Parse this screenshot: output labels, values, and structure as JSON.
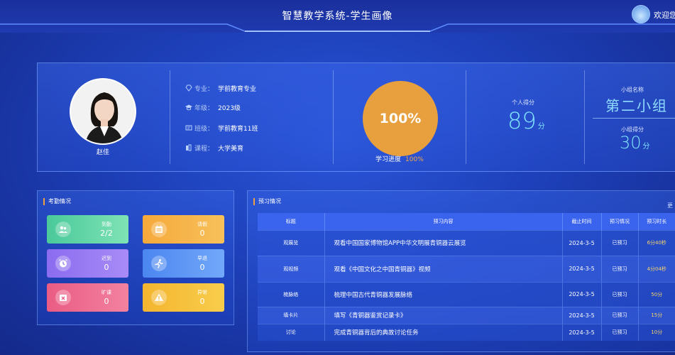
{
  "header": {
    "title": "智慧教学系统-学生画像",
    "welcome": "欢迎您"
  },
  "profile": {
    "name": "赵佳",
    "info": [
      {
        "label": "专业：",
        "value": "学前教育专业",
        "icon": "diamond-icon"
      },
      {
        "label": "年级：",
        "value": "2023级",
        "icon": "graduation-cap-icon"
      },
      {
        "label": "班级：",
        "value": "学前教育11班",
        "icon": "class-icon"
      },
      {
        "label": "课程：",
        "value": "大学美育",
        "icon": "books-icon"
      }
    ],
    "progress": {
      "percent_text": "100%",
      "label": "学习进度",
      "value": "100%",
      "value_fraction": 1.0
    },
    "personal_score": {
      "label": "个人得分",
      "value": "89",
      "unit": "分"
    },
    "group": {
      "name_label": "小组名称",
      "name": "第二小组",
      "score_label": "小组得分",
      "score": "30",
      "unit": "分"
    }
  },
  "attendance": {
    "title": "考勤情况",
    "tiles": [
      {
        "label": "到勤",
        "value": "2/2",
        "icon": "people-icon",
        "color": "#4ac99a"
      },
      {
        "label": "请假",
        "value": "0",
        "icon": "calendar-icon",
        "color": "#f6a93b"
      },
      {
        "label": "迟到",
        "value": "0",
        "icon": "alarm-clock-icon",
        "color": "#8b6cf0"
      },
      {
        "label": "早退",
        "value": "0",
        "icon": "running-icon",
        "color": "#4b86f0"
      },
      {
        "label": "旷课",
        "value": "0",
        "icon": "calendar-x-icon",
        "color": "#ea5c84"
      },
      {
        "label": "异常",
        "value": "0",
        "icon": "warning-icon",
        "color": "#f4b52f"
      }
    ]
  },
  "preview": {
    "title": "预习情况",
    "more": "更",
    "columns": [
      "标题",
      "预习内容",
      "截止时间",
      "预习情况",
      "预习时长"
    ],
    "rows": [
      {
        "title": "观展览",
        "content": "观看中国国家博物馆APP中华文明展青铜器云展览",
        "deadline": "2024-3-5",
        "status": "已预习",
        "duration": "6分40秒"
      },
      {
        "title": "观视频",
        "content": "观看《中国文化之中国青铜器》视频",
        "deadline": "2024-3-5",
        "status": "已预习",
        "duration": "4分04秒"
      },
      {
        "title": "梳脉络",
        "content": "梳理中国古代青铜器发展脉络",
        "deadline": "2024-3-5",
        "status": "已预习",
        "duration": "50分"
      },
      {
        "title": "填卡片",
        "content": "填写《青铜器鉴赏记录卡》",
        "deadline": "2024-3-5",
        "status": "已预习",
        "duration": "15分"
      },
      {
        "title": "讨论",
        "content": "完成青铜器背后的典故讨论任务",
        "deadline": "2024-3-5",
        "status": "已预习",
        "duration": "10分"
      }
    ]
  },
  "colors": {
    "accent_orange": "#e8a03e",
    "score_cyan": "#7fe3ff",
    "table_header": "#3b64ee"
  }
}
